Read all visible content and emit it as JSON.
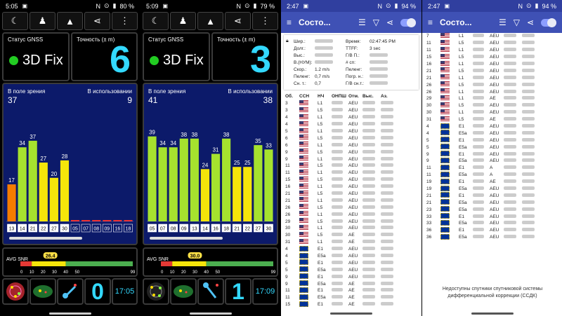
{
  "phones": [
    {
      "status": {
        "time": "5:05",
        "battery": "80 %"
      },
      "toolbar": [
        "☾",
        "♟",
        "▲",
        "⋖",
        "⋮"
      ],
      "gnss_label": "Статус GNSS",
      "fix": "3D Fix",
      "acc_label": "Точность (± m)",
      "acc": "6",
      "in_view_label": "В поле зрения",
      "in_use_label": "В использовании",
      "in_view": "37",
      "in_use": "9",
      "avg_label": "AVG SNR",
      "avg_value": "26.4",
      "scale": [
        "00",
        "10",
        "20",
        "30",
        "40",
        "50",
        "99"
      ],
      "bottom_count": "0",
      "bottom_time": "17:05"
    },
    {
      "status": {
        "time": "5:09",
        "battery": "79 %"
      },
      "toolbar": [
        "☾",
        "♟",
        "▲",
        "⋖",
        "⋮"
      ],
      "gnss_label": "Статус GNSS",
      "fix": "3D Fix",
      "acc_label": "Точность (± m)",
      "acc": "3",
      "in_view_label": "В поле зрения",
      "in_use_label": "В использовании",
      "in_view": "41",
      "in_use": "38",
      "avg_label": "AVG SNR",
      "avg_value": "30.0",
      "scale": [
        "00",
        "10",
        "20",
        "30",
        "40",
        "50",
        "99"
      ],
      "bottom_count": "1",
      "bottom_time": "17:09"
    }
  ],
  "chart_data": [
    {
      "type": "bar",
      "categories": [
        "13",
        "14",
        "21",
        "22",
        "27",
        "30",
        "05",
        "07",
        "08",
        "09",
        "16",
        "18"
      ],
      "values": [
        17,
        34,
        37,
        27,
        20,
        28,
        0,
        0,
        0,
        0,
        0,
        0
      ]
    },
    {
      "type": "bar",
      "categories": [
        "05",
        "07",
        "08",
        "09",
        "13",
        "14",
        "16",
        "18",
        "21",
        "22",
        "27",
        "30"
      ],
      "values": [
        39,
        34,
        34,
        38,
        38,
        24,
        31,
        38,
        25,
        25,
        35,
        33
      ]
    }
  ],
  "app": {
    "status": {
      "time": "2:47",
      "battery": "94 %"
    },
    "title": "Состо...",
    "info_left": [
      "Шир.:",
      "Долг.:",
      "Выс.:",
      "В.(НУМ):",
      "Скор.:",
      "Пеленг:",
      "Сн. т.:"
    ],
    "info_left_vals": [
      "",
      "",
      "",
      "",
      "1.2 m/s",
      "0,7 m/s",
      "0,7"
    ],
    "info_right": [
      "Время:",
      "TTFF:",
      "Г/В П.:",
      "# сп:",
      "Пеленг:",
      "Погр. н.:",
      "Г/В сн.т.:"
    ],
    "info_right_vals": [
      "02:47:45 PM",
      "3 sec",
      "",
      "",
      "",
      "",
      ""
    ],
    "headers": [
      "Об.",
      "ССН",
      "НЧ",
      "ОНПШ",
      "Отм.",
      "Выс.",
      "Аз."
    ],
    "rows": [
      [
        "3",
        "us",
        "L1",
        "AEU"
      ],
      [
        "3",
        "us",
        "L5",
        "AEU"
      ],
      [
        "4",
        "us",
        "L1",
        "AEU"
      ],
      [
        "4",
        "us",
        "L5",
        "AEU"
      ],
      [
        "5",
        "us",
        "L1",
        "AEU"
      ],
      [
        "6",
        "us",
        "L5",
        "AEU"
      ],
      [
        "6",
        "us",
        "L1",
        "AEU"
      ],
      [
        "9",
        "us",
        "L5",
        "AEU"
      ],
      [
        "9",
        "us",
        "L1",
        "AEU"
      ],
      [
        "11",
        "us",
        "L5",
        "AEU"
      ],
      [
        "11",
        "us",
        "L1",
        "AEU"
      ],
      [
        "15",
        "us",
        "L5",
        "AEU"
      ],
      [
        "16",
        "us",
        "L1",
        "AEU"
      ],
      [
        "21",
        "us",
        "L5",
        "AEU"
      ],
      [
        "21",
        "us",
        "L1",
        "AEU"
      ],
      [
        "26",
        "us",
        "L5",
        "AEU"
      ],
      [
        "26",
        "us",
        "L1",
        "AEU"
      ],
      [
        "29",
        "us",
        "L5",
        "AEU"
      ],
      [
        "30",
        "us",
        "L1",
        "AEU"
      ],
      [
        "30",
        "us",
        "L5",
        "AE"
      ],
      [
        "31",
        "us",
        "L1",
        "AE"
      ],
      [
        "4",
        "eu",
        "E1",
        "AEU"
      ],
      [
        "4",
        "eu",
        "E5a",
        "AEU"
      ],
      [
        "5",
        "eu",
        "E1",
        "AEU"
      ],
      [
        "5",
        "eu",
        "E5a",
        "AEU"
      ],
      [
        "9",
        "eu",
        "E1",
        "AEU"
      ],
      [
        "9",
        "eu",
        "E5a",
        "AE"
      ],
      [
        "11",
        "eu",
        "E1",
        "AE"
      ],
      [
        "11",
        "eu",
        "E5a",
        "AE"
      ],
      [
        "15",
        "eu",
        "E1",
        "AE"
      ]
    ],
    "rows2": [
      [
        "7",
        "us",
        "L1",
        "AEU"
      ],
      [
        "11",
        "us",
        "L5",
        "AEU"
      ],
      [
        "11",
        "us",
        "L1",
        "AEU"
      ],
      [
        "15",
        "us",
        "L5",
        "AEU"
      ],
      [
        "16",
        "us",
        "L1",
        "AEU"
      ],
      [
        "21",
        "us",
        "L5",
        "AEU"
      ],
      [
        "21",
        "us",
        "L1",
        "AEU"
      ],
      [
        "26",
        "us",
        "L5",
        "AEU"
      ],
      [
        "26",
        "us",
        "L1",
        "AEU"
      ],
      [
        "29",
        "us",
        "L1",
        "AE"
      ],
      [
        "30",
        "us",
        "L5",
        "AEU"
      ],
      [
        "30",
        "us",
        "L1",
        "AEU"
      ],
      [
        "31",
        "us",
        "L5",
        "AE"
      ],
      [
        "4",
        "eu",
        "E1",
        "AEU"
      ],
      [
        "4",
        "eu",
        "E5a",
        "AEU"
      ],
      [
        "5",
        "eu",
        "E1",
        "AEU"
      ],
      [
        "5",
        "eu",
        "E5a",
        "AEU"
      ],
      [
        "9",
        "eu",
        "E1",
        "AEU"
      ],
      [
        "9",
        "eu",
        "E5a",
        "AEU"
      ],
      [
        "11",
        "eu",
        "E1",
        "A"
      ],
      [
        "11",
        "eu",
        "E5a",
        "A"
      ],
      [
        "19",
        "eu",
        "E1",
        "AE"
      ],
      [
        "19",
        "eu",
        "E5a",
        "AEU"
      ],
      [
        "21",
        "eu",
        "E1",
        "AEU"
      ],
      [
        "21",
        "eu",
        "E5a",
        "AEU"
      ],
      [
        "23",
        "eu",
        "E5a",
        "AEU"
      ],
      [
        "33",
        "eu",
        "E1",
        "AEU"
      ],
      [
        "33",
        "eu",
        "E5a",
        "AEU"
      ],
      [
        "36",
        "eu",
        "E1",
        "AEU"
      ],
      [
        "36",
        "eu",
        "E5a",
        "AEU"
      ]
    ],
    "note": "Недоступны спутники спутниковой системы дифференциальной коррекции (ССДК)"
  }
}
